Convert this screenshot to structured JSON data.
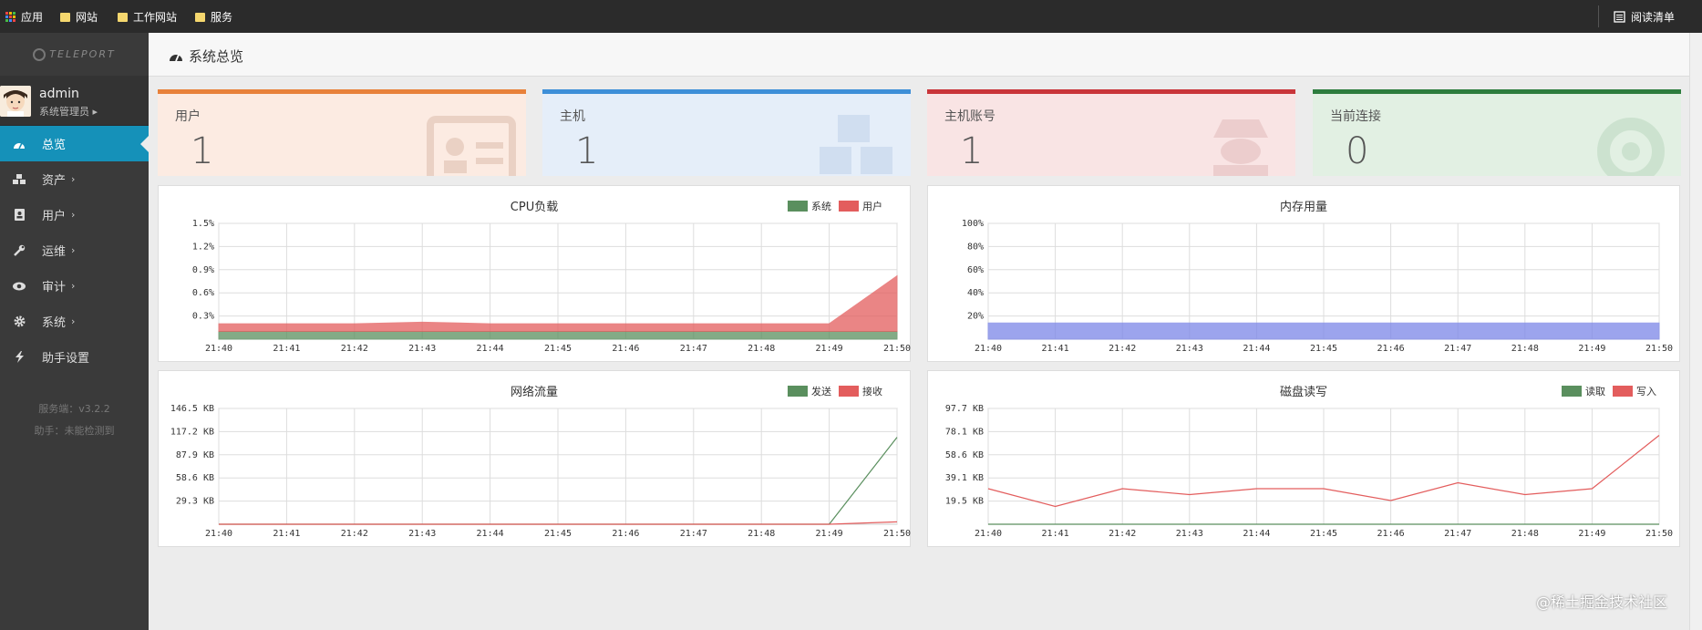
{
  "bookmarks": {
    "apps": "应用",
    "items": [
      "网站",
      "工作网站",
      "服务"
    ],
    "reading_list": "阅读清单"
  },
  "sidebar": {
    "logo": "TELEPORT",
    "user_name": "admin",
    "user_role": "系统管理员",
    "items": [
      {
        "label": "总览",
        "icon": "dashboard-icon",
        "active": true
      },
      {
        "label": "资产",
        "icon": "cubes-icon",
        "chevron": "›"
      },
      {
        "label": "用户",
        "icon": "id-card-icon",
        "chevron": "›"
      },
      {
        "label": "运维",
        "icon": "wrench-icon",
        "chevron": "›"
      },
      {
        "label": "审计",
        "icon": "eye-icon",
        "chevron": "›"
      },
      {
        "label": "系统",
        "icon": "gear-icon",
        "chevron": "›"
      },
      {
        "label": "助手设置",
        "icon": "bolt-icon"
      }
    ],
    "server_version": "服务端：v3.2.2",
    "assistant_status": "助手：未能检测到"
  },
  "header": {
    "title": "系统总览",
    "icon": "dashboard-icon"
  },
  "stats": [
    {
      "label": "用户",
      "value": "1",
      "color": "#e8813a",
      "bg": "#fcebe2"
    },
    {
      "label": "主机",
      "value": "1",
      "color": "#3d8fd8",
      "bg": "#e5eef9"
    },
    {
      "label": "主机账号",
      "value": "1",
      "color": "#c9353a",
      "bg": "#f9e4e4"
    },
    {
      "label": "当前连接",
      "value": "0",
      "color": "#2d7d3e",
      "bg": "#e2f0e3"
    }
  ],
  "chart_data": [
    {
      "type": "area",
      "title": "CPU负载",
      "x": [
        "21:40",
        "21:41",
        "21:42",
        "21:43",
        "21:44",
        "21:45",
        "21:46",
        "21:47",
        "21:48",
        "21:49",
        "21:50"
      ],
      "y_ticks": [
        "0.3%",
        "0.6%",
        "0.9%",
        "1.2%",
        "1.5%"
      ],
      "ylim": [
        0,
        1.5
      ],
      "series": [
        {
          "name": "系统",
          "color": "#5a8f5e",
          "values": [
            0.1,
            0.1,
            0.1,
            0.1,
            0.1,
            0.1,
            0.1,
            0.1,
            0.1,
            0.1,
            0.1
          ]
        },
        {
          "name": "用户",
          "color": "#e35d5d",
          "values": [
            0.1,
            0.1,
            0.1,
            0.12,
            0.1,
            0.1,
            0.1,
            0.1,
            0.1,
            0.1,
            0.72
          ]
        }
      ]
    },
    {
      "type": "area",
      "title": "内存用量",
      "x": [
        "21:40",
        "21:41",
        "21:42",
        "21:43",
        "21:44",
        "21:45",
        "21:46",
        "21:47",
        "21:48",
        "21:49",
        "21:50"
      ],
      "y_ticks": [
        "20%",
        "40%",
        "60%",
        "80%",
        "100%"
      ],
      "ylim": [
        0,
        100
      ],
      "series": [
        {
          "name": "",
          "color": "#7b86e8",
          "values": [
            14,
            14,
            14,
            14,
            14,
            14,
            14,
            14,
            14,
            14,
            14
          ]
        }
      ]
    },
    {
      "type": "line",
      "title": "网络流量",
      "x": [
        "21:40",
        "21:41",
        "21:42",
        "21:43",
        "21:44",
        "21:45",
        "21:46",
        "21:47",
        "21:48",
        "21:49",
        "21:50"
      ],
      "y_ticks": [
        "29.3 KB",
        "58.6 KB",
        "87.9 KB",
        "117.2 KB",
        "146.5 KB"
      ],
      "ylim": [
        0,
        146.5
      ],
      "series": [
        {
          "name": "发送",
          "color": "#5a8f5e",
          "values": [
            0,
            0,
            0,
            0,
            0,
            0,
            0,
            0,
            0,
            0,
            110
          ]
        },
        {
          "name": "接收",
          "color": "#e35d5d",
          "values": [
            0,
            0,
            0,
            0,
            0,
            0,
            0,
            0,
            0,
            0,
            3
          ]
        }
      ]
    },
    {
      "type": "line",
      "title": "磁盘读写",
      "x": [
        "21:40",
        "21:41",
        "21:42",
        "21:43",
        "21:44",
        "21:45",
        "21:46",
        "21:47",
        "21:48",
        "21:49",
        "21:50"
      ],
      "y_ticks": [
        "19.5 KB",
        "39.1 KB",
        "58.6 KB",
        "78.1 KB",
        "97.7 KB"
      ],
      "ylim": [
        0,
        97.7
      ],
      "series": [
        {
          "name": "读取",
          "color": "#5a8f5e",
          "values": [
            0,
            0,
            0,
            0,
            0,
            0,
            0,
            0,
            0,
            0,
            0
          ]
        },
        {
          "name": "写入",
          "color": "#e35d5d",
          "values": [
            30,
            15,
            30,
            25,
            30,
            30,
            20,
            35,
            25,
            30,
            75
          ]
        }
      ]
    }
  ],
  "watermark": "@稀土掘金技术社区"
}
